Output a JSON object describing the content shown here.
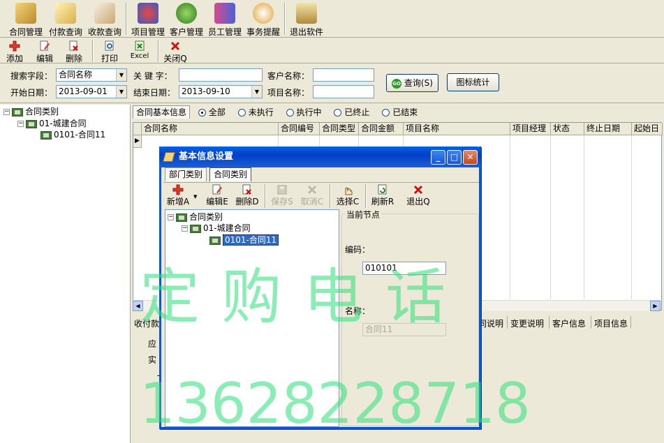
{
  "toolbar_main": {
    "items": [
      {
        "label": "合同管理",
        "icon": "contract-icon"
      },
      {
        "label": "付款查询",
        "icon": "payment-icon"
      },
      {
        "label": "收款查询",
        "icon": "receipt-icon"
      },
      {
        "label": "项目管理",
        "icon": "project-icon"
      },
      {
        "label": "客户管理",
        "icon": "customer-icon"
      },
      {
        "label": "员工管理",
        "icon": "staff-icon"
      },
      {
        "label": "事务提醒",
        "icon": "reminder-icon"
      },
      {
        "label": "退出软件",
        "icon": "exit-icon"
      }
    ]
  },
  "toolbar_edit": {
    "add": "添加",
    "edit": "编辑",
    "delete": "删除",
    "print": "打印",
    "excel": "Excel",
    "close": "关闭Q"
  },
  "search": {
    "field_label": "搜索字段：",
    "field_value": "合同名称",
    "keyword_label": "关 键 字：",
    "keyword_value": "",
    "customer_label": "客户名称：",
    "customer_value": "",
    "start_label": "开始日期：",
    "start_value": "2013-09-01",
    "end_label": "结束日期：",
    "end_value": "2013-09-10",
    "project_label": "项目名称：",
    "project_value": "",
    "query_button": "查询(S)",
    "chart_button": "图标统计"
  },
  "tree": {
    "root": "合同类别",
    "child": "01-城建合同",
    "leaf": "0101-合同11"
  },
  "filter": {
    "tab": "合同基本信息",
    "options": [
      "全部",
      "未执行",
      "执行中",
      "已终止",
      "已结束"
    ],
    "selected": "全部"
  },
  "grid": {
    "columns": [
      "合同名称",
      "合同编号",
      "合同类型",
      "合同金额",
      "项目名称",
      "项目经理",
      "状态",
      "终止日期",
      "起始日"
    ]
  },
  "bottom_panel": {
    "left_tab": "收付款",
    "tabs": [
      "同说明",
      "变更说明",
      "客户信息",
      "项目信息"
    ],
    "labels": [
      "应",
      "实",
      "ㄧ"
    ]
  },
  "dialog": {
    "title": "基本信息设置",
    "tabs": [
      "部门类别",
      "合同类别"
    ],
    "active_tab": "合同类别",
    "tools": {
      "new": "新增A",
      "edit": "编辑E",
      "delete": "删除D",
      "save": "保存S",
      "cancel": "取消C",
      "select": "选择C",
      "refresh": "刷新R",
      "exit": "退出Q"
    },
    "tree": {
      "root": "合同类别",
      "child": "01-城建合同",
      "leaf": "0101-合同11"
    },
    "group_title": "当前节点",
    "code_label": "编码：",
    "code_value": "010101",
    "name_label": "名称：",
    "name_value": "合同11"
  },
  "watermark": {
    "line1": "定  购  电  话",
    "line2": "13628228718"
  }
}
